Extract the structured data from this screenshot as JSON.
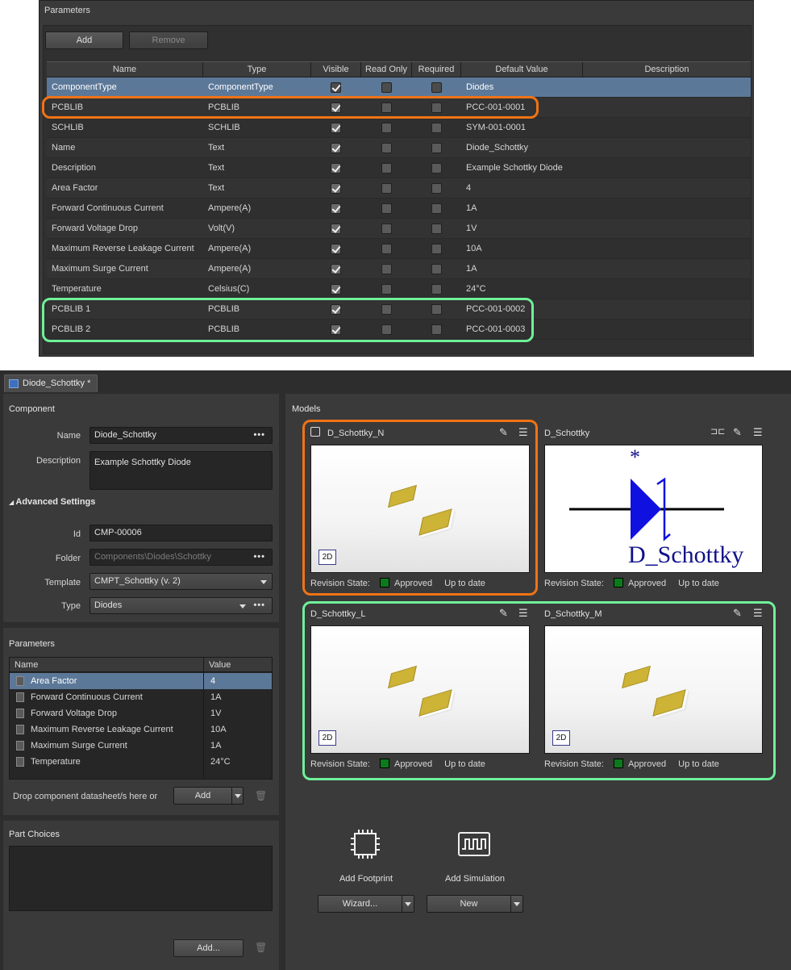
{
  "top_panel": {
    "title": "Parameters",
    "add_label": "Add",
    "remove_label": "Remove",
    "columns": [
      "Name",
      "Type",
      "Visible",
      "Read Only",
      "Required",
      "Default Value",
      "Description"
    ],
    "rows": [
      {
        "name": "ComponentType",
        "type": "ComponentType",
        "visible": true,
        "read_only": false,
        "required": false,
        "default": "Diodes",
        "description": ""
      },
      {
        "name": "PCBLIB",
        "type": "PCBLIB",
        "visible": true,
        "read_only": false,
        "required": false,
        "default": "PCC-001-0001",
        "description": ""
      },
      {
        "name": "SCHLIB",
        "type": "SCHLIB",
        "visible": true,
        "read_only": false,
        "required": false,
        "default": "SYM-001-0001",
        "description": ""
      },
      {
        "name": "Name",
        "type": "Text",
        "visible": true,
        "read_only": false,
        "required": false,
        "default": "Diode_Schottky",
        "description": ""
      },
      {
        "name": "Description",
        "type": "Text",
        "visible": true,
        "read_only": false,
        "required": false,
        "default": "Example Schottky Diode",
        "description": ""
      },
      {
        "name": "Area Factor",
        "type": "Text",
        "visible": true,
        "read_only": false,
        "required": false,
        "default": "4",
        "description": ""
      },
      {
        "name": "Forward Continuous Current",
        "type": "Ampere(A)",
        "visible": true,
        "read_only": false,
        "required": false,
        "default": "1A",
        "description": ""
      },
      {
        "name": "Forward Voltage Drop",
        "type": "Volt(V)",
        "visible": true,
        "read_only": false,
        "required": false,
        "default": "1V",
        "description": ""
      },
      {
        "name": "Maximum Reverse Leakage Current",
        "type": "Ampere(A)",
        "visible": true,
        "read_only": false,
        "required": false,
        "default": "10A",
        "description": ""
      },
      {
        "name": "Maximum Surge Current",
        "type": "Ampere(A)",
        "visible": true,
        "read_only": false,
        "required": false,
        "default": "1A",
        "description": ""
      },
      {
        "name": "Temperature",
        "type": "Celsius(C)",
        "visible": true,
        "read_only": false,
        "required": false,
        "default": "24°C",
        "description": ""
      },
      {
        "name": "PCBLIB 1",
        "type": "PCBLIB",
        "visible": true,
        "read_only": false,
        "required": false,
        "default": "PCC-001-0002",
        "description": ""
      },
      {
        "name": "PCBLIB 2",
        "type": "PCBLIB",
        "visible": true,
        "read_only": false,
        "required": false,
        "default": "PCC-001-0003",
        "description": ""
      }
    ]
  },
  "tab": {
    "label": "Diode_Schottky *",
    "icon": "component-icon"
  },
  "component": {
    "section_title": "Component",
    "name_label": "Name",
    "name_value": "Diode_Schottky",
    "description_label": "Description",
    "description_value": "Example Schottky Diode",
    "advanced_title": "Advanced Settings",
    "id_label": "Id",
    "id_value": "CMP-00006",
    "folder_label": "Folder",
    "folder_value": "Components\\Diodes\\Schottky",
    "template_label": "Template",
    "template_value": "CMPT_Schottky (v. 2)",
    "type_label": "Type",
    "type_value": "Diodes",
    "more": "•••"
  },
  "parameters": {
    "section_title": "Parameters",
    "col_name": "Name",
    "col_value": "Value",
    "rows": [
      {
        "name": "Area Factor",
        "value": "4"
      },
      {
        "name": "Forward Continuous Current",
        "value": "1A"
      },
      {
        "name": "Forward Voltage Drop",
        "value": "1V"
      },
      {
        "name": "Maximum Reverse Leakage Current",
        "value": "10A"
      },
      {
        "name": "Maximum Surge Current",
        "value": "1A"
      },
      {
        "name": "Temperature",
        "value": "24°C"
      }
    ],
    "drop_text": "Drop component datasheet/s here or",
    "add_label": "Add"
  },
  "part_choices": {
    "section_title": "Part Choices",
    "add_label": "Add..."
  },
  "models": {
    "section_title": "Models",
    "items": [
      {
        "title": "D_Schottky_N",
        "kind": "pcb",
        "badge": "2D",
        "rev_label": "Revision State:",
        "state": "Approved",
        "status": "Up to date"
      },
      {
        "title": "D_Schottky",
        "kind": "sch",
        "symbol_text": "D_Schottky",
        "star": "*",
        "rev_label": "Revision State:",
        "state": "Approved",
        "status": "Up to date"
      },
      {
        "title": "D_Schottky_L",
        "kind": "pcb",
        "badge": "2D",
        "rev_label": "Revision State:",
        "state": "Approved",
        "status": "Up to date"
      },
      {
        "title": "D_Schottky_M",
        "kind": "pcb",
        "badge": "2D",
        "rev_label": "Revision State:",
        "state": "Approved",
        "status": "Up to date"
      }
    ],
    "add_footprint_label": "Add Footprint",
    "add_simulation_label": "Add Simulation",
    "wizard_label": "Wizard...",
    "new_label": "New"
  },
  "colors": {
    "highlight_orange": "#f07316",
    "highlight_green": "#6ff09a",
    "approved": "#0c7a1c",
    "selection": "#5c7898"
  }
}
